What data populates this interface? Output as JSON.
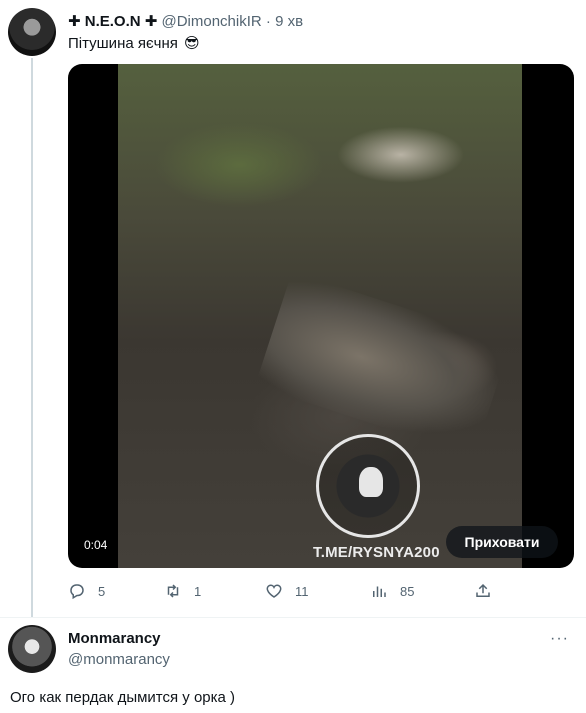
{
  "tweet": {
    "author_name": "✚ N.E.O.N ✚",
    "handle": "@DimonchikIR",
    "separator": "·",
    "time": "9 хв",
    "text": "Пітушина яєчня",
    "emoji": "😎",
    "media": {
      "timer": "0:04",
      "hide_button": "Приховати",
      "watermark": "T.ME/RYSNYA200"
    },
    "actions": {
      "replies": "5",
      "retweets": "1",
      "likes": "11",
      "views": "85"
    }
  },
  "reply": {
    "author_name": "Monmarancy",
    "handle": "@monmarancy",
    "more": "···",
    "text": "Ого как пердак дымится у орка )"
  },
  "colors": {
    "text": "#0f1419",
    "secondary": "#536471",
    "border": "#eff3f4",
    "thread": "#cfd9de"
  }
}
